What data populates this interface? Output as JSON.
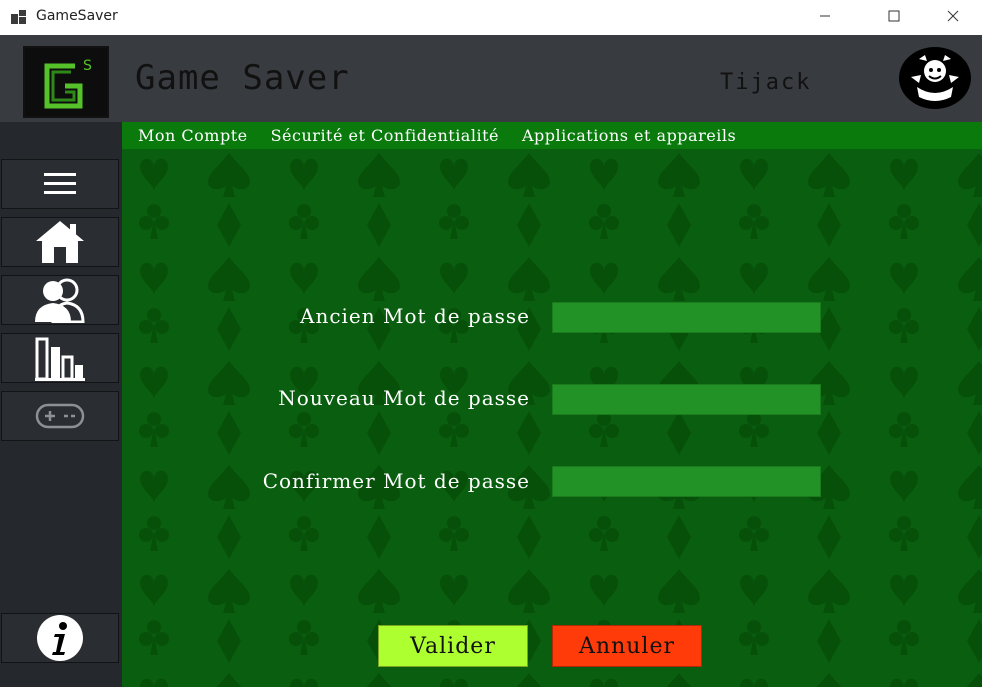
{
  "window": {
    "title": "GameSaver",
    "controls": [
      "minimize-icon",
      "maximize-icon",
      "close-icon"
    ]
  },
  "header": {
    "logo_text": "GS",
    "app_name": "Game Saver",
    "username": "Tijack"
  },
  "sidebar": {
    "items": [
      {
        "icon": "menu-icon"
      },
      {
        "icon": "home-icon"
      },
      {
        "icon": "users-icon"
      },
      {
        "icon": "stats-icon"
      },
      {
        "icon": "gamepad-icon"
      }
    ],
    "info_icon": "info-icon"
  },
  "nav": {
    "tabs": [
      {
        "label": "Mon Compte"
      },
      {
        "label": "Sécurité et Confidentialité"
      },
      {
        "label": "Applications et appareils"
      }
    ]
  },
  "form": {
    "old_password_label": "Ancien Mot de passe",
    "new_password_label": "Nouveau Mot de passe",
    "confirm_password_label": "Confirmer Mot de passe",
    "old_password_value": "",
    "new_password_value": "",
    "confirm_password_value": ""
  },
  "actions": {
    "validate_label": "Valider",
    "cancel_label": "Annuler"
  },
  "colors": {
    "header_bg": "#383b40",
    "sidebar_bg": "#25282c",
    "nav_bg": "#0a7a0d",
    "main_bg": "#0a5e0f",
    "input_bg": "#229226",
    "validate_bg": "#adff2f",
    "cancel_bg": "#ff3b0a"
  }
}
